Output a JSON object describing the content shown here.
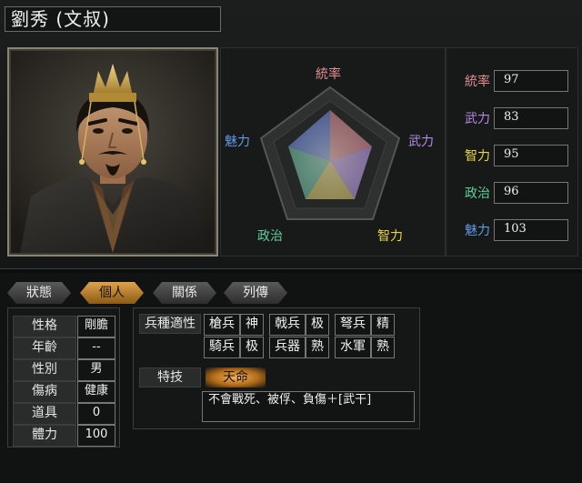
{
  "character": {
    "name": "劉秀 (文叔)"
  },
  "radar": {
    "labels": {
      "leadership": "統率",
      "war": "武力",
      "intelligence": "智力",
      "politics": "政治",
      "charisma": "魅力"
    }
  },
  "stats": [
    {
      "label": "統率",
      "value": "97",
      "color": "#e48c94"
    },
    {
      "label": "武力",
      "value": "83",
      "color": "#b48ae6"
    },
    {
      "label": "智力",
      "value": "95",
      "color": "#e8d64a"
    },
    {
      "label": "政治",
      "value": "96",
      "color": "#5ecf9a"
    },
    {
      "label": "魅力",
      "value": "103",
      "color": "#5f9be6"
    }
  ],
  "tabs": [
    {
      "label": "狀態",
      "active": false
    },
    {
      "label": "個人",
      "active": true
    },
    {
      "label": "關係",
      "active": false
    },
    {
      "label": "列傳",
      "active": false
    }
  ],
  "info": [
    {
      "label": "性格",
      "value": "剛膽"
    },
    {
      "label": "年齡",
      "value": "--"
    },
    {
      "label": "性別",
      "value": "男"
    },
    {
      "label": "傷病",
      "value": "健康"
    },
    {
      "label": "道具",
      "value": "0"
    },
    {
      "label": "體力",
      "value": "100"
    }
  ],
  "troops": {
    "title": "兵種適性",
    "rows": [
      [
        {
          "type": "槍兵",
          "rank": "神"
        },
        {
          "type": "戟兵",
          "rank": "极"
        },
        {
          "type": "弩兵",
          "rank": "精"
        }
      ],
      [
        {
          "type": "騎兵",
          "rank": "极"
        },
        {
          "type": "兵器",
          "rank": "熟"
        },
        {
          "type": "水軍",
          "rank": "熟"
        }
      ]
    ]
  },
  "skill": {
    "title": "特技",
    "name": "天命",
    "description": "不會戰死、被俘、負傷＋[武干]"
  }
}
